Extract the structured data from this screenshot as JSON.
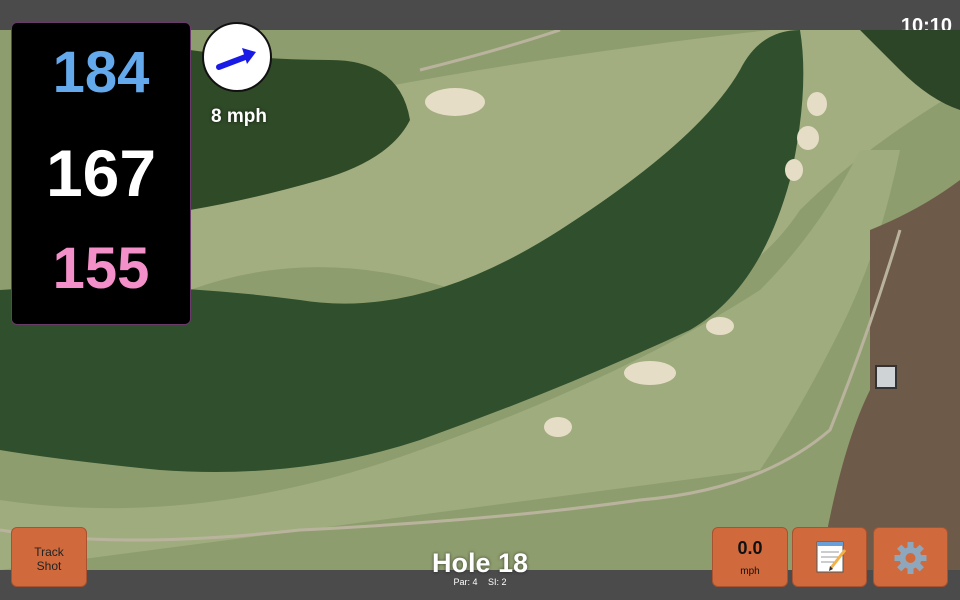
{
  "status": {
    "time": "10:10"
  },
  "distances": {
    "back": "184",
    "middle": "167",
    "front": "155"
  },
  "distance_colors": {
    "back": "#64a9ec",
    "middle": "#ffffff",
    "front": "#f38fc9"
  },
  "wind": {
    "speed_label": "8 mph",
    "icon": "wind-direction-arrow-icon",
    "arrow_color": "#1a1ae6"
  },
  "buttons": {
    "track_shot_line1": "Track",
    "track_shot_line2": "Shot",
    "wind_value": "0.0",
    "wind_unit": "mph",
    "notes_icon": "notepad-icon",
    "settings_icon": "gear-icon",
    "button_color": "#d06a3c"
  },
  "hole": {
    "title": "Hole 18",
    "par": "Par: 4",
    "si": "SI: 2"
  }
}
